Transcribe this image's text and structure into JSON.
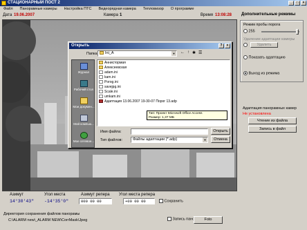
{
  "app": {
    "title": "СТАЦИОНАРНЫЙ ПОСТ 2"
  },
  "menu": [
    "Файл",
    "Панорамные камеры",
    "Настройка ПТС",
    "Видеорядная камера",
    "Тепловизор",
    "О программе"
  ],
  "info": {
    "date_label": "Дата",
    "date_value": "19.06.2007",
    "camera_label": "Камера",
    "camera_value": "1",
    "time_label": "Время",
    "time_value": "13:08:28"
  },
  "right_panel": {
    "title": "Дополнительные режимы",
    "threshold_group_label": "Режим пробы порога",
    "threshold_value": "255",
    "remove_adapt_label": "Удаление адаптации камеры",
    "remove_adapt_button": "Удалить",
    "show_adapt_label": "Показать адаптацию",
    "exit_mode_label": "Выход из режима",
    "adapt_title": "Адаптация панорамных камер",
    "adapt_status": "Не установлена",
    "read_button": "Чтение из файла",
    "write_button": "Запись в файл",
    "colors": {
      "status": "#ff0000"
    }
  },
  "bottom": {
    "azimuth_label": "Азимут",
    "azimuth_value": "14°30'43\"",
    "angle_label": "Угол места",
    "angle_value": "-14°35'0\"",
    "ref_azimuth_label": "Азимут репера",
    "ref_azimuth_value": "000  00   00",
    "ref_angle_label": "Угол места репера",
    "ref_angle_value": "+00  00   00",
    "save_label": "Сохранить",
    "dir_label": "Директория сохранения файлов панорамы",
    "dir_value": "C:\\ALARM new\\_ALARM NEW\\CorrMask\\Jpeg",
    "save_pano_label": "Запись панорамы",
    "photo_button": "Foto"
  },
  "dialog": {
    "title": "Открыть",
    "folder_label": "Папка:",
    "folder_value": "Ini_A",
    "places": [
      "Журнал",
      "Рабочий стол",
      "Мои докумен...",
      "Мой компью...",
      "Мое сетевое..."
    ],
    "files": [
      {
        "name": "Аннистормая",
        "type": "folder"
      },
      {
        "name": "Алексеевская",
        "type": "folder"
      },
      {
        "name": "adam.ini",
        "type": "ini"
      },
      {
        "name": "kam.ini",
        "type": "ini"
      },
      {
        "name": "Porog.ini",
        "type": "ini"
      },
      {
        "name": "savejpg.ini",
        "type": "ini"
      },
      {
        "name": "Scale.ini",
        "type": "ini"
      },
      {
        "name": "umkam.ini",
        "type": "ini"
      },
      {
        "name": "Адаптация 13.06.2007  19-30-07  Порог 13.adp",
        "type": "adp"
      }
    ],
    "tooltip_line1": "Тип: Проект Microsoft Office Access",
    "tooltip_line2": "Размер: 1,37 МБ",
    "filename_label": "Имя файла:",
    "filetype_label": "Тип файлов:",
    "filetype_value": "Файлы адаптации (*.adp)",
    "open_button": "Открыть",
    "cancel_button": "Отмена"
  }
}
